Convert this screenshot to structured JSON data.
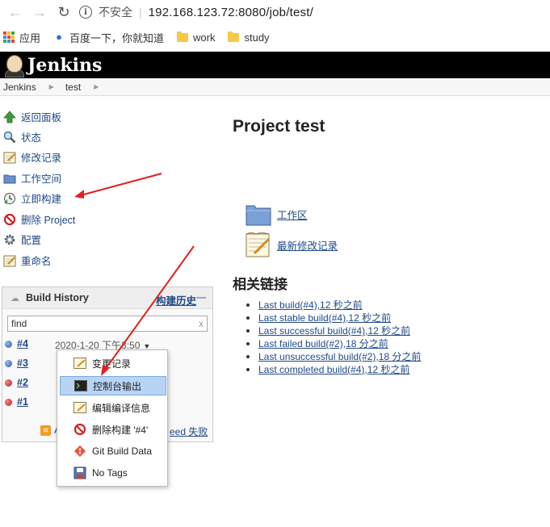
{
  "browser": {
    "back_icon": "arrow-left-icon",
    "forward_icon": "arrow-right-icon",
    "reload_icon": "reload-icon",
    "insecure_label": "不安全",
    "url": "192.168.123.72:8080/job/test/"
  },
  "bookmarks": [
    {
      "label": "应用",
      "icon": "apps-icon"
    },
    {
      "label": "百度一下，你就知道",
      "icon": "baidu-paw-icon"
    },
    {
      "label": "work",
      "icon": "folder-icon"
    },
    {
      "label": "study",
      "icon": "folder-icon"
    }
  ],
  "header": {
    "title": "Jenkins"
  },
  "breadcrumb": [
    "Jenkins",
    "test"
  ],
  "sidebar": {
    "tasks": [
      {
        "label": "返回面板",
        "icon": "up-arrow-icon"
      },
      {
        "label": "状态",
        "icon": "search-icon"
      },
      {
        "label": "修改记录",
        "icon": "notepad-icon"
      },
      {
        "label": "工作空间",
        "icon": "folder-icon"
      },
      {
        "label": "立即构建",
        "icon": "clock-build-icon"
      },
      {
        "label": "删除 Project",
        "icon": "no-entry-icon"
      },
      {
        "label": "配置",
        "icon": "gear-icon"
      },
      {
        "label": "重命名",
        "icon": "notepad-icon"
      }
    ]
  },
  "build_history": {
    "title": "Build History",
    "trend_label": "构建历史",
    "trend_dash": "—",
    "search_value": "find",
    "search_clear": "x",
    "builds": [
      {
        "number": "#4",
        "status": "blue",
        "date": "2020-1-20 下午3:50"
      },
      {
        "number": "#3",
        "status": "blue"
      },
      {
        "number": "#2",
        "status": "red"
      },
      {
        "number": "#1",
        "status": "red"
      }
    ],
    "footer_feed": "A",
    "footer_fail": "eed 失败"
  },
  "context_menu": {
    "items": [
      {
        "label": "变更记录",
        "icon": "notepad-icon"
      },
      {
        "label": "控制台输出",
        "icon": "terminal-icon",
        "active": true
      },
      {
        "label": "编辑编译信息",
        "icon": "notepad-icon"
      },
      {
        "label": "删除构建 '#4'",
        "icon": "no-entry-icon"
      },
      {
        "label": "Git Build Data",
        "icon": "git-icon"
      },
      {
        "label": "No Tags",
        "icon": "save-icon"
      }
    ]
  },
  "main": {
    "title": "Project test",
    "workspace_link": "工作区",
    "changes_link": "最新修改记录",
    "related_title": "相关链接",
    "related_links": [
      "Last build(#4),12 秒之前",
      "Last stable build(#4),12 秒之前",
      "Last successful build(#4),12 秒之前",
      "Last failed build(#2),18 分之前",
      "Last unsuccessful build(#2),18 分之前",
      "Last completed build(#4),12 秒之前"
    ]
  },
  "colors": {
    "link": "#204a87",
    "header_bg": "#000000",
    "annotation_arrow": "#e02020",
    "active_menu": "#b8d4f5"
  }
}
